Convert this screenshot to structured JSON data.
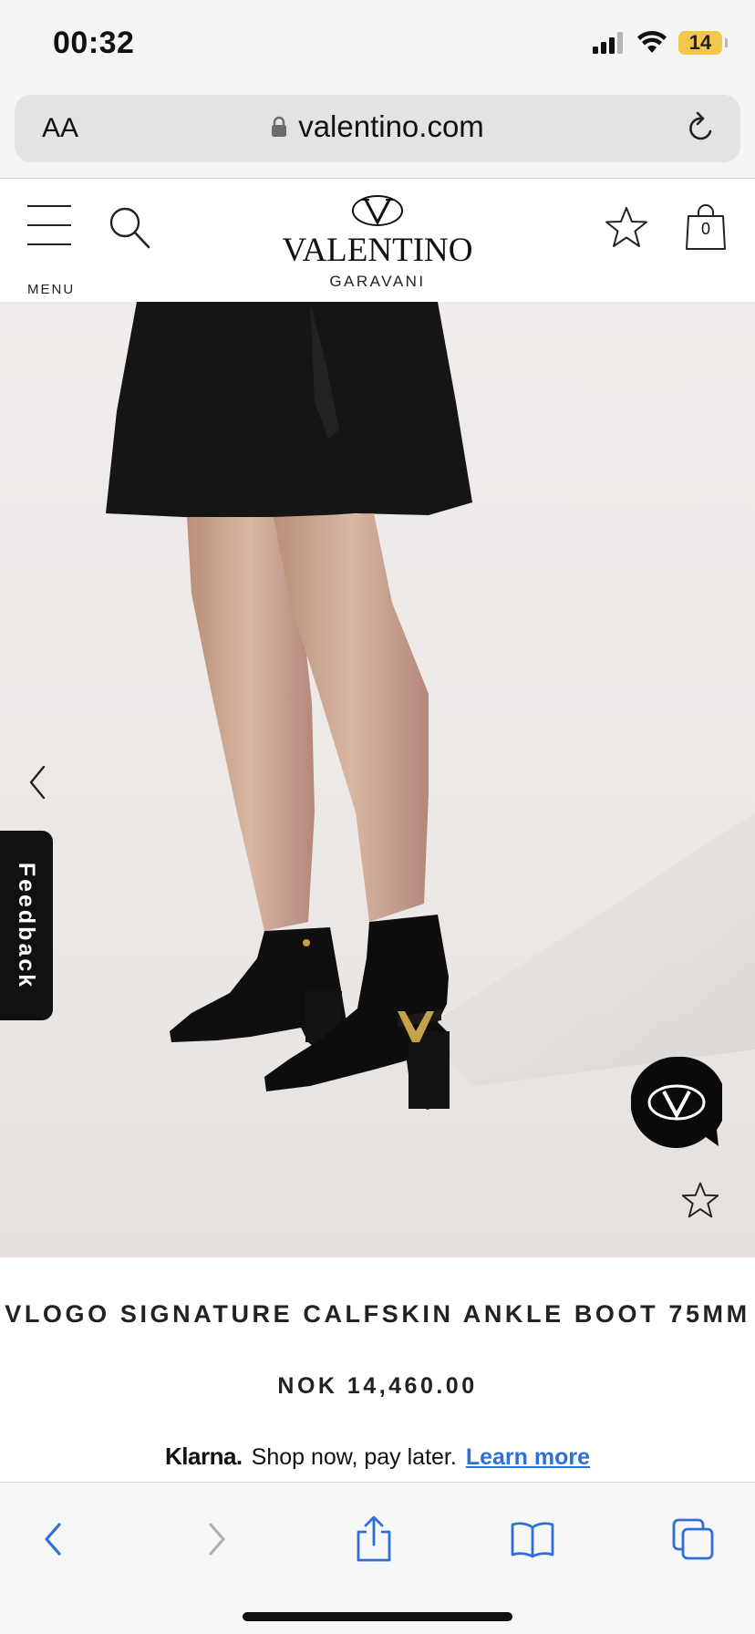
{
  "status_bar": {
    "time": "00:32",
    "battery_level": "14",
    "battery_color": "#f3c74c"
  },
  "browser": {
    "text_size_button": "AA",
    "url": "valentino.com",
    "icons": {
      "lock": "lock-icon",
      "reload": "reload-icon"
    }
  },
  "header": {
    "menu_label": "MENU",
    "logo_word": "VALENTINO",
    "logo_sub": "GARAVANI",
    "bag_count": "0",
    "icons": {
      "menu": "hamburger-icon",
      "search": "search-icon",
      "wishlist": "star-icon",
      "bag": "shopping-bag-icon"
    }
  },
  "gallery": {
    "feedback_label": "Feedback",
    "icons": {
      "previous": "chevron-left-icon",
      "chat": "valentino-chat-icon",
      "wishlist": "star-icon"
    }
  },
  "product": {
    "title": "VLOGO SIGNATURE CALFSKIN ANKLE BOOT 75MM",
    "price": "NOK 14,460.00"
  },
  "klarna": {
    "brand": "Klarna.",
    "text": "Shop now, pay later.",
    "link": "Learn more",
    "link_color": "#2f6fd8"
  },
  "toolbar": {
    "icons": [
      "back-icon",
      "forward-icon",
      "share-icon",
      "bookmarks-icon",
      "tabs-icon"
    ]
  }
}
